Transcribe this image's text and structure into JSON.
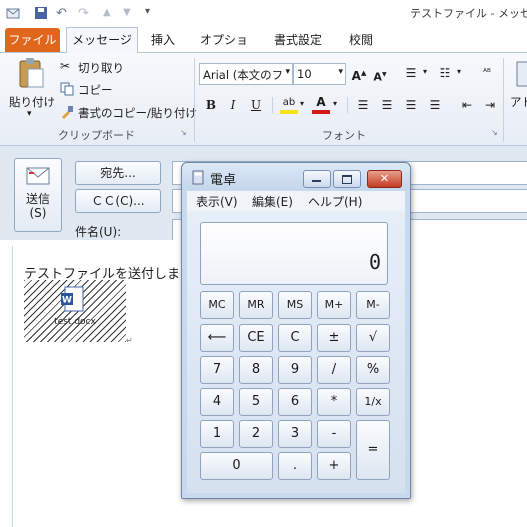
{
  "window": {
    "title": "テストファイル - メッセージ"
  },
  "ribbon": {
    "tabs": [
      "ファイル",
      "メッセージ",
      "挿入",
      "オプション",
      "書式設定",
      "校閲"
    ],
    "clipboard": {
      "paste": "貼り付け",
      "cut": "切り取り",
      "copy": "コピー",
      "format_painter": "書式のコピー/貼り付け",
      "group_label": "クリップボード"
    },
    "font": {
      "name": "Arial (本文のフ",
      "size": "10",
      "group_label": "フォント"
    },
    "extra_label": "アド"
  },
  "form": {
    "send_label": "送信",
    "send_key": "(S)",
    "to_button": "宛先...",
    "cc_button": "ＣＣ(C)...",
    "subject_label": "件名(U):"
  },
  "body": {
    "text": "テストファイルを送付しま",
    "attachment_name": "test.docx"
  },
  "calculator": {
    "title": "電卓",
    "menus": [
      "表示(V)",
      "編集(E)",
      "ヘルプ(H)"
    ],
    "display": "0",
    "keys": [
      [
        "MC",
        "MR",
        "MS",
        "M+",
        "M-"
      ],
      [
        "⟵",
        "CE",
        "C",
        "±",
        "√"
      ],
      [
        "7",
        "8",
        "9",
        "/",
        "%"
      ],
      [
        "4",
        "5",
        "6",
        "*",
        "1/x"
      ],
      [
        "1",
        "2",
        "3",
        "-",
        "="
      ],
      [
        "0",
        ".",
        "+"
      ]
    ]
  }
}
